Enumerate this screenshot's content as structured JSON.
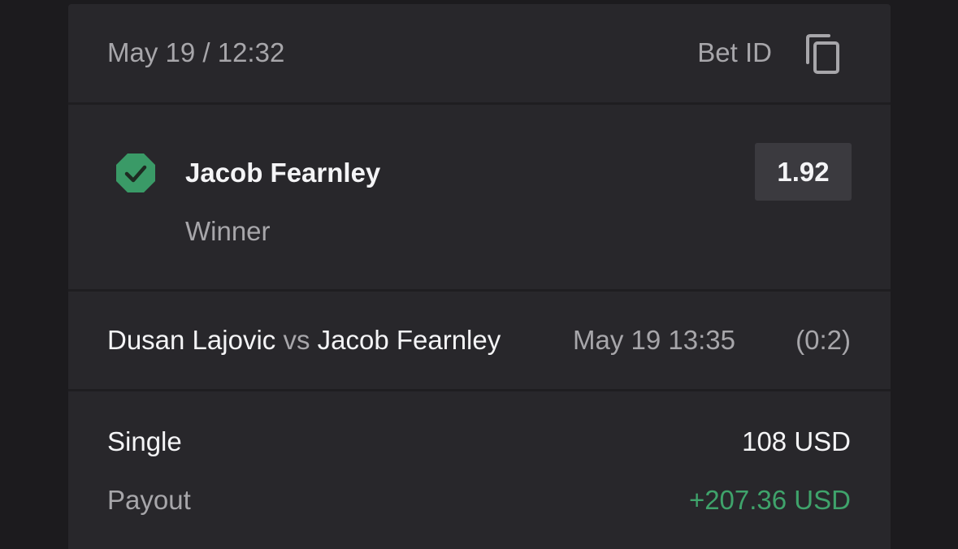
{
  "header": {
    "datetime": "May 19 / 12:32",
    "bet_id_label": "Bet ID",
    "copy_icon": "copy-icon"
  },
  "selection": {
    "status_icon": "check-circle-icon",
    "status_color": "#3a9a67",
    "name": "Jacob Fearnley",
    "market": "Winner",
    "odds": "1.92"
  },
  "event": {
    "team_home": "Dusan Lajovic",
    "vs": "vs",
    "team_away": "Jacob Fearnley",
    "datetime": "May 19 13:35",
    "score": "(0:2)"
  },
  "stake": {
    "type": "Single",
    "amount": "108 USD",
    "payout_label": "Payout",
    "payout_amount": "+207.36 USD",
    "payout_color": "#3fa36b"
  }
}
